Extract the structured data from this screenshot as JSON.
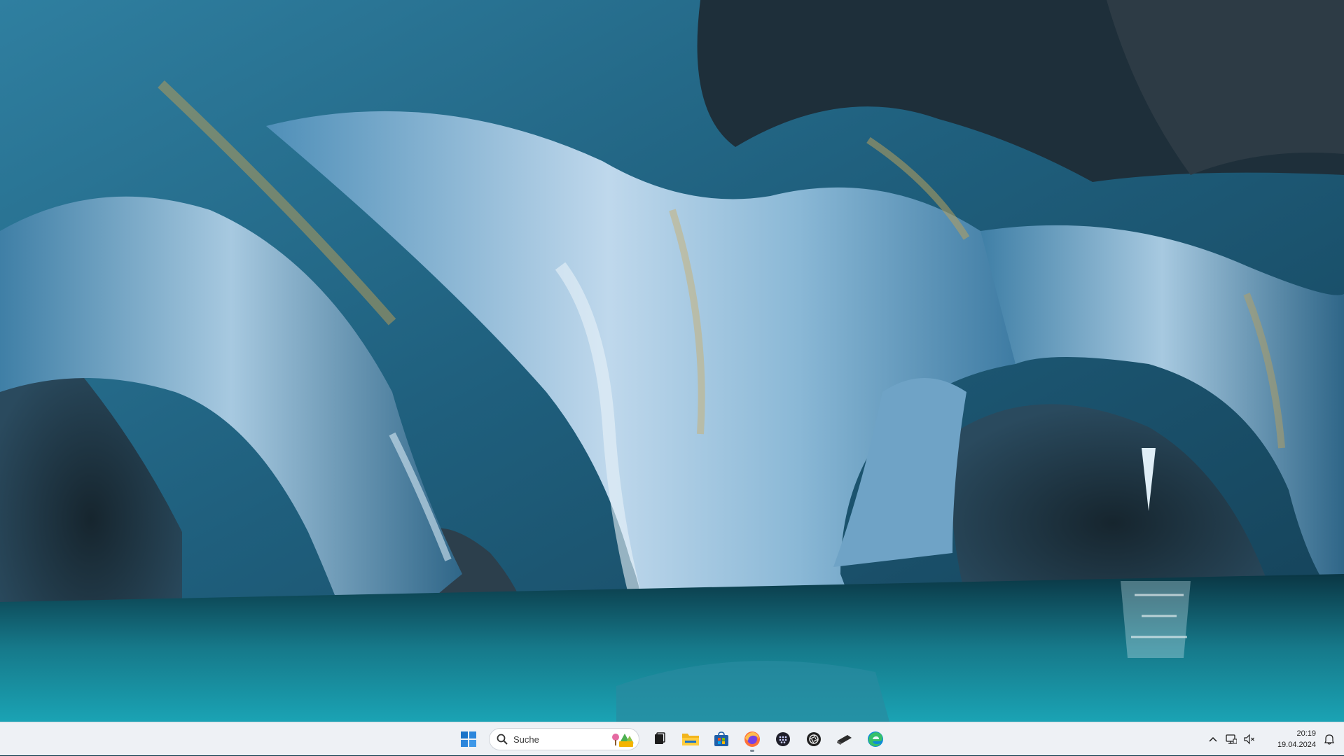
{
  "taskbar": {
    "search": {
      "placeholder": "Suche"
    },
    "apps": [
      {
        "name": "Start"
      },
      {
        "name": "Task View"
      },
      {
        "name": "File Explorer"
      },
      {
        "name": "Microsoft Store"
      },
      {
        "name": "Firefox"
      },
      {
        "name": "App"
      },
      {
        "name": "App"
      },
      {
        "name": "App"
      },
      {
        "name": "Microsoft Edge"
      }
    ],
    "tray": {
      "time": "20:19",
      "date": "19.04.2024"
    }
  },
  "colors": {
    "taskbar_bg": "#eef1f5",
    "accent": "#1a73c8"
  },
  "icons": {
    "start": "windows-logo-icon",
    "search": "search-icon",
    "search_highlight": "trees-highlight-icon",
    "task_view": "task-view-icon",
    "file_explorer": "folder-icon",
    "store": "store-bag-icon",
    "firefox": "firefox-icon",
    "dots_app": "dots-grid-app-icon",
    "aperture_app": "aperture-app-icon",
    "stylus_app": "stylus-app-icon",
    "edge": "edge-icon",
    "hidden_icons": "chevron-up-icon",
    "network": "network-icon",
    "volume_muted": "volume-muted-icon",
    "notifications": "bell-icon"
  }
}
